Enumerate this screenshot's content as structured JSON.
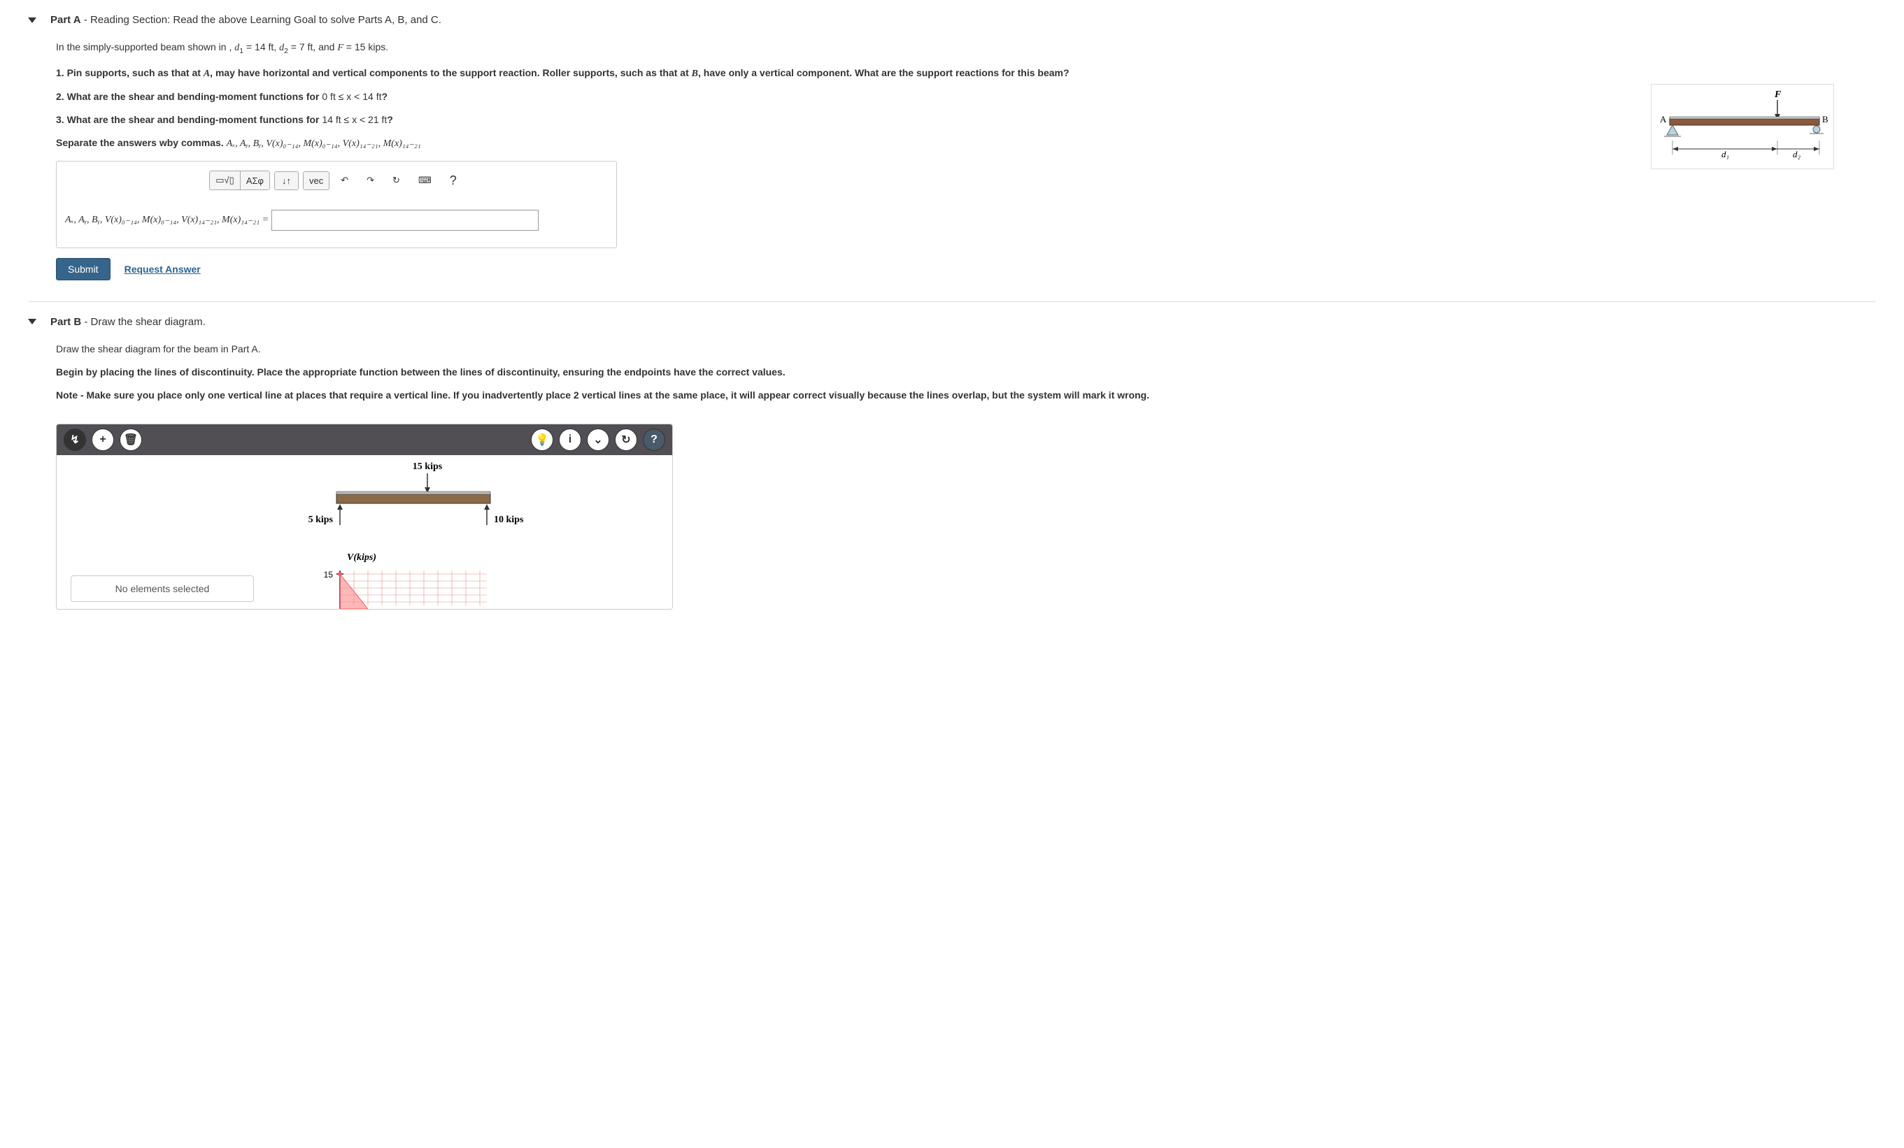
{
  "partA": {
    "header_bold": "Part A",
    "header_rest": " - Reading Section: Read the above Learning Goal to solve Parts A, B, and C.",
    "intro_pre": "In the simply-supported beam shown in , ",
    "d1_sym": "d",
    "d1_sub": "1",
    "d1_eq": " = 14 ft, ",
    "d2_sym": "d",
    "d2_sub": "2",
    "d2_eq": " = 7 ft, and ",
    "F_sym": "F",
    "F_eq": " = 15 kips.",
    "q1_a": "1. Pin supports, such as that at ",
    "q1_A": "A",
    "q1_b": ", may have horizontal and vertical components to the support reaction. Roller supports, such as that at ",
    "q1_B": "B",
    "q1_c": ", have only a vertical component. What are the support reactions for this beam?",
    "q2_a": "2. What are the shear and bending-moment functions for ",
    "q2_range": "0 ft ≤ x < 14 ft",
    "q2_b": "?",
    "q3_a": "3. What are the shear and bending-moment functions for ",
    "q3_range": "14 ft ≤ x < 21 ft",
    "q3_b": "?",
    "sep_a": "Separate the answers wby commas. ",
    "sep_expr": "Aₓ, Aᵧ, Bᵧ, V(x)₀₋₁₄, M(x)₀₋₁₄, V(x)₁₄₋₂₁, M(x)₁₄₋₂₁",
    "answer_label": "Aₓ, Aᵧ, Bᵧ, V(x)₀₋₁₄, M(x)₀₋₁₄, V(x)₁₄₋₂₁, M(x)₁₄₋₂₁ =",
    "toolbar": {
      "templates": "▭√▯",
      "greek": "ΑΣφ",
      "subscript": "↓↑",
      "vec": "vec",
      "undo": "↶",
      "redo": "↷",
      "reset": "↻",
      "keyboard": "⌨",
      "help": "?"
    },
    "submit": "Submit",
    "request": "Request Answer",
    "figure": {
      "F": "F",
      "A": "A",
      "B": "B",
      "d1": "d₁",
      "d2": "d₂"
    }
  },
  "partB": {
    "header_bold": "Part B",
    "header_rest": " - Draw the shear diagram.",
    "line1": "Draw the shear diagram for the beam in Part A.",
    "line2": "Begin by placing the lines of discontinuity. Place the appropriate function between the lines of discontinuity, ensuring the endpoints have the correct values.",
    "line3": "Note - Make sure you place only one vertical line at places that require a vertical line. If you inadvertently place 2 vertical lines at the same place, it will appear correct visually because the lines overlap, but the system will mark it wrong.",
    "tools": {
      "pointer": "↯",
      "add": "+",
      "trash": "🗑",
      "hint": "💡",
      "info": "i",
      "collapse": "⌄",
      "reset": "↻",
      "help": "?"
    },
    "canvas": {
      "top_force": "15 kips",
      "left_react": "5 kips",
      "right_react": "10 kips",
      "ylabel": "V(kips)",
      "ytick": "15",
      "selection": "No elements selected"
    }
  }
}
